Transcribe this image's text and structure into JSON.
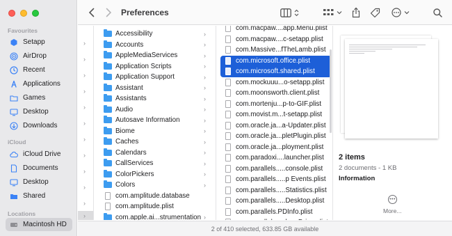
{
  "window": {
    "title": "Preferences",
    "status_text": "2 of 410 selected, 633.85 GB available"
  },
  "sidebar": {
    "sections": [
      {
        "title": "Favourites",
        "items": [
          {
            "label": "Setapp",
            "icon": "setapp-icon"
          },
          {
            "label": "AirDrop",
            "icon": "airdrop-icon"
          },
          {
            "label": "Recent",
            "icon": "recent-icon"
          },
          {
            "label": "Applications",
            "icon": "applications-icon"
          },
          {
            "label": "Games",
            "icon": "folder-icon"
          },
          {
            "label": "Desktop",
            "icon": "desktop-icon"
          },
          {
            "label": "Downloads",
            "icon": "downloads-icon"
          }
        ]
      },
      {
        "title": "iCloud",
        "items": [
          {
            "label": "iCloud Drive",
            "icon": "cloud-icon"
          },
          {
            "label": "Documents",
            "icon": "document-icon"
          },
          {
            "label": "Desktop",
            "icon": "desktop-icon"
          },
          {
            "label": "Shared",
            "icon": "shared-folder-icon"
          }
        ]
      },
      {
        "title": "Locations",
        "items": [
          {
            "label": "Macintosh HD",
            "icon": "hard-drive-icon",
            "selected": true
          }
        ]
      }
    ]
  },
  "column2": {
    "items": [
      {
        "label": "Accessibility",
        "type": "folder",
        "has_children": true
      },
      {
        "label": "Accounts",
        "type": "folder",
        "has_children": true
      },
      {
        "label": "AppleMediaServices",
        "type": "folder",
        "has_children": true
      },
      {
        "label": "Application Scripts",
        "type": "folder",
        "has_children": true
      },
      {
        "label": "Application Support",
        "type": "folder",
        "has_children": true
      },
      {
        "label": "Assistant",
        "type": "folder",
        "has_children": true
      },
      {
        "label": "Assistants",
        "type": "folder",
        "has_children": true
      },
      {
        "label": "Audio",
        "type": "folder",
        "has_children": true
      },
      {
        "label": "Autosave Information",
        "type": "folder",
        "has_children": true
      },
      {
        "label": "Biome",
        "type": "folder",
        "has_children": true
      },
      {
        "label": "Caches",
        "type": "folder",
        "has_children": true
      },
      {
        "label": "Calendars",
        "type": "folder",
        "has_children": true
      },
      {
        "label": "CallServices",
        "type": "folder",
        "has_children": true
      },
      {
        "label": "ColorPickers",
        "type": "folder",
        "has_children": true
      },
      {
        "label": "Colors",
        "type": "folder",
        "has_children": true
      },
      {
        "label": "com.amplitude.database",
        "type": "file",
        "has_children": false
      },
      {
        "label": "com.amplitude.plist",
        "type": "file",
        "has_children": false
      },
      {
        "label": "com.apple.ai...strumentation",
        "type": "folder",
        "has_children": true
      }
    ]
  },
  "column3": {
    "items": [
      {
        "label": "com.macpaw....app.Menu.plist"
      },
      {
        "label": "com.macpaw....c-setapp.plist"
      },
      {
        "label": "com.Massive...fTheLamb.plist"
      },
      {
        "label": "com.microsoft.office.plist",
        "selected": true
      },
      {
        "label": "com.microsoft.shared.plist",
        "selected": true
      },
      {
        "label": "com.mockuuu...o-setapp.plist"
      },
      {
        "label": "com.moonsworth.client.plist"
      },
      {
        "label": "com.mortenju...p-to-GIF.plist"
      },
      {
        "label": "com.movist.m...t-setapp.plist"
      },
      {
        "label": "com.oracle.ja...a-Updater.plist"
      },
      {
        "label": "com.oracle.ja...pletPlugin.plist"
      },
      {
        "label": "com.oracle.ja...ployment.plist"
      },
      {
        "label": "com.paradoxi....launcher.plist"
      },
      {
        "label": "com.parallels.....console.plist"
      },
      {
        "label": "com.parallels.....p Events.plist"
      },
      {
        "label": "com.parallels.....Statistics.plist"
      },
      {
        "label": "com.parallels.....Desktop.plist"
      },
      {
        "label": "com.parallels.PDInfo.plist"
      },
      {
        "label": "com.parallels.....loanDrive.plist"
      }
    ]
  },
  "preview": {
    "count_label": "2 items",
    "summary": "2 documents - 1 KB",
    "info_label": "Information",
    "more_label": "More..."
  },
  "colors": {
    "selection": "#1d5fd8",
    "folder": "#3d9cf0",
    "sidebar_bg": "#e9e9eb",
    "sidebar_icon": "#3b82f6"
  }
}
